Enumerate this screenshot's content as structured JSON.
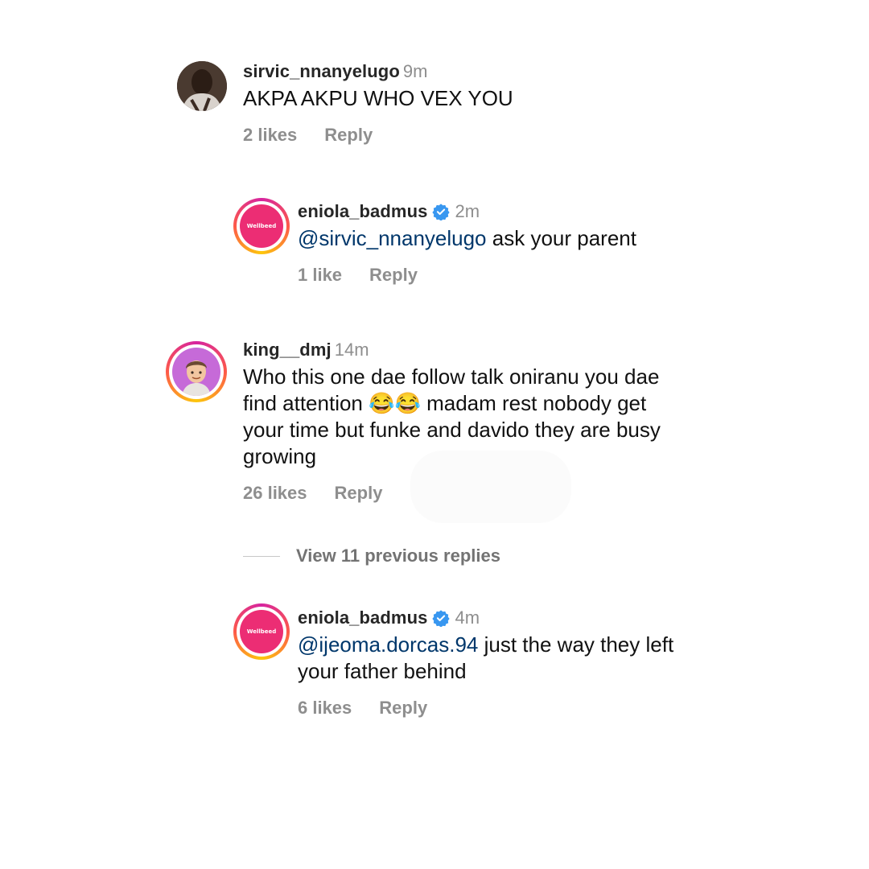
{
  "colors": {
    "mention": "#00376b",
    "meta": "#8e8e8e",
    "verified": "#3897f0",
    "brand_pink": "#ec2d74"
  },
  "comments": [
    {
      "username": "sirvic_nnanyelugo",
      "time": "9m",
      "text": "AKPA AKPU WHO VEX YOU",
      "likes": "2 likes",
      "reply_label": "Reply",
      "avatar_icon": "user-photo-avatar"
    },
    {
      "username": "eniola_badmus",
      "verified": true,
      "time": "2m",
      "mention": "@sirvic_nnanyelugo",
      "text": " ask your parent",
      "likes": "1 like",
      "reply_label": "Reply",
      "avatar_text": "Wellbeed"
    },
    {
      "username": "king__dmj",
      "time": "14m",
      "text_lines": [
        "Who this one dae follow talk oniranu you dae",
        "find attention 😂😂 madam rest nobody get",
        "your time but funke and davido they are busy",
        "growing"
      ],
      "likes": "26 likes",
      "reply_label": "Reply",
      "avatar_icon": "memoji-avatar"
    },
    {
      "username": "eniola_badmus",
      "verified": true,
      "time": "4m",
      "mention": "@ijeoma.dorcas.94",
      "text_line1": " just the way they left",
      "text_line2": "your father behind",
      "likes": "6 likes",
      "reply_label": "Reply",
      "avatar_text": "Wellbeed"
    }
  ],
  "view_replies_label": "View 11 previous replies"
}
